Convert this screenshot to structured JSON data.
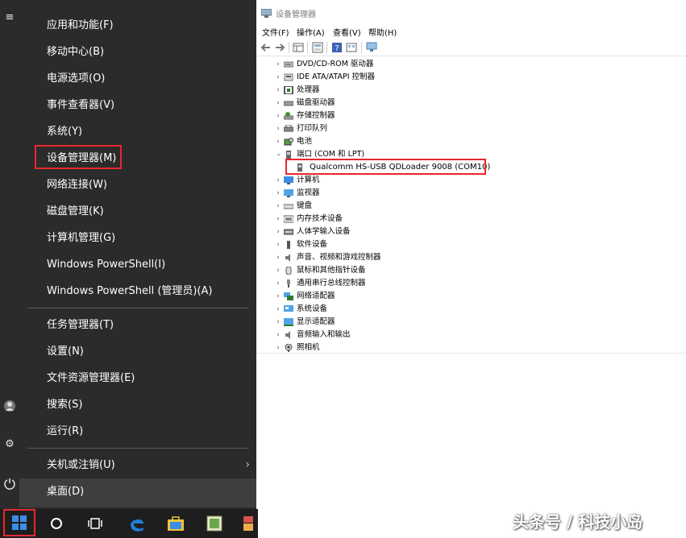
{
  "winx_menu": {
    "items": [
      {
        "label": "应用和功能(F)"
      },
      {
        "label": "移动中心(B)"
      },
      {
        "label": "电源选项(O)"
      },
      {
        "label": "事件查看器(V)"
      },
      {
        "label": "系统(Y)"
      },
      {
        "label": "设备管理器(M)",
        "highlighted": true
      },
      {
        "label": "网络连接(W)"
      },
      {
        "label": "磁盘管理(K)"
      },
      {
        "label": "计算机管理(G)"
      },
      {
        "label": "Windows PowerShell(I)"
      },
      {
        "label": "Windows PowerShell (管理员)(A)"
      },
      {
        "label": "任务管理器(T)"
      },
      {
        "label": "设置(N)"
      },
      {
        "label": "文件资源管理器(E)"
      },
      {
        "label": "搜索(S)"
      },
      {
        "label": "运行(R)"
      },
      {
        "label": "关机或注销(U)",
        "has_submenu": true
      },
      {
        "label": "桌面(D)"
      }
    ]
  },
  "taskbar": {
    "icons": [
      "start-icon",
      "cortana-circle-icon",
      "task-view-icon",
      "edge-icon",
      "store-icon",
      "app-icon"
    ]
  },
  "device_manager": {
    "title": "设备管理器",
    "menu": [
      "文件(F)",
      "操作(A)",
      "查看(V)",
      "帮助(H)"
    ],
    "tree": [
      {
        "label": "DVD/CD-ROM 驱动器",
        "icon": "dvd-icon",
        "expanded": false
      },
      {
        "label": "IDE ATA/ATAPI 控制器",
        "icon": "ide-icon",
        "expanded": false
      },
      {
        "label": "处理器",
        "icon": "processor-icon",
        "expanded": false
      },
      {
        "label": "磁盘驱动器",
        "icon": "disk-icon",
        "expanded": false
      },
      {
        "label": "存储控制器",
        "icon": "storage-icon",
        "expanded": false
      },
      {
        "label": "打印队列",
        "icon": "printer-icon",
        "expanded": false
      },
      {
        "label": "电池",
        "icon": "battery-icon",
        "expanded": false
      },
      {
        "label": "端口 (COM 和 LPT)",
        "icon": "port-icon",
        "expanded": true
      },
      {
        "label": "Qualcomm HS-USB QDLoader 9008 (COM10)",
        "icon": "port-device-icon",
        "child": true,
        "highlighted": true
      },
      {
        "label": "计算机",
        "icon": "computer-icon",
        "expanded": false
      },
      {
        "label": "监视器",
        "icon": "monitor-icon",
        "expanded": false
      },
      {
        "label": "键盘",
        "icon": "keyboard-icon",
        "expanded": false
      },
      {
        "label": "内存技术设备",
        "icon": "memory-icon",
        "expanded": false
      },
      {
        "label": "人体学输入设备",
        "icon": "hid-icon",
        "expanded": false
      },
      {
        "label": "软件设备",
        "icon": "software-device-icon",
        "expanded": false
      },
      {
        "label": "声音、视频和游戏控制器",
        "icon": "sound-icon",
        "expanded": false
      },
      {
        "label": "鼠标和其他指针设备",
        "icon": "mouse-icon",
        "expanded": false
      },
      {
        "label": "通用串行总线控制器",
        "icon": "usb-icon",
        "expanded": false
      },
      {
        "label": "网络适配器",
        "icon": "network-icon",
        "expanded": false
      },
      {
        "label": "系统设备",
        "icon": "system-device-icon",
        "expanded": false
      },
      {
        "label": "显示适配器",
        "icon": "display-adapter-icon",
        "expanded": false
      },
      {
        "label": "音频输入和输出",
        "icon": "audio-icon",
        "expanded": false
      },
      {
        "label": "照相机",
        "icon": "camera-icon",
        "expanded": false
      }
    ]
  },
  "watermark": "头条号 / 科技小岛",
  "colors": {
    "menu_bg": "#2b2b2b",
    "highlight_red": "#e8272e",
    "taskbar_bg": "#1e1e1e",
    "start_blue": "#3a8ee6"
  }
}
